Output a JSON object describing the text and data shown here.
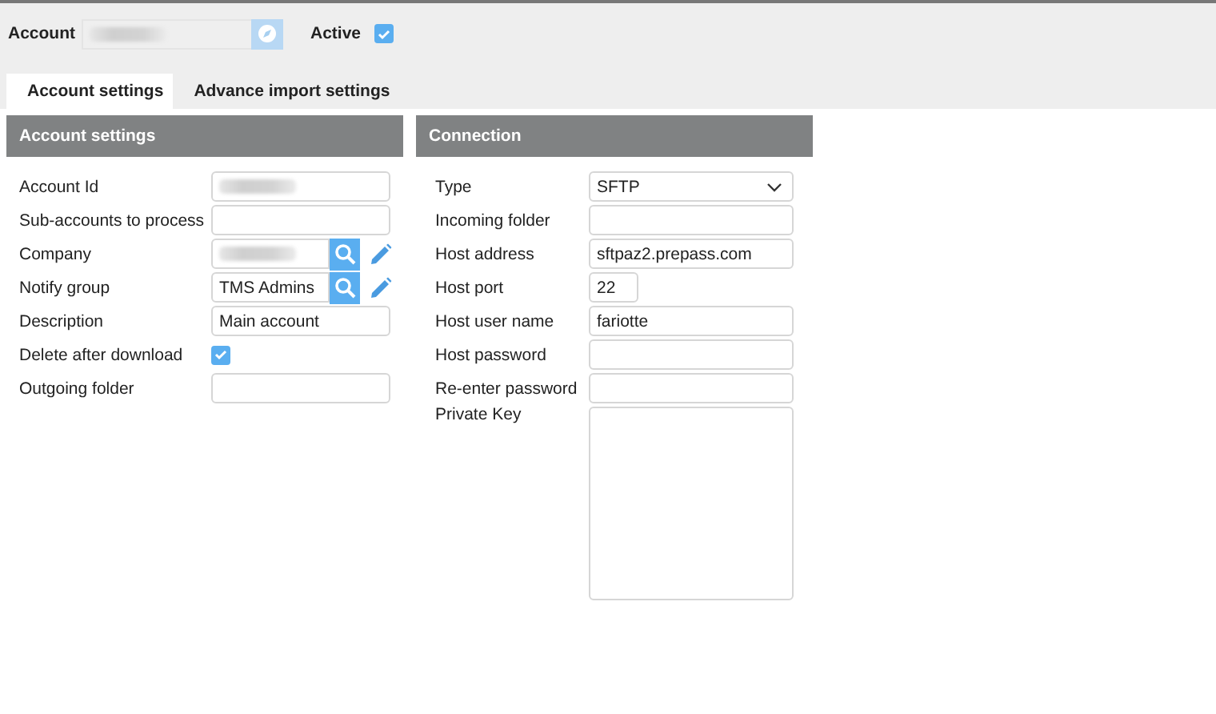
{
  "header": {
    "account": {
      "label": "Account",
      "blurred": true
    },
    "active": {
      "label": "Active",
      "checked": true
    }
  },
  "tabs": [
    {
      "label": "Account settings",
      "selected": true
    },
    {
      "label": "Advance import settings",
      "selected": false
    }
  ],
  "panels": [
    {
      "title": "Account settings",
      "fields": [
        {
          "label": "Account Id",
          "kind": "text",
          "blurred": true
        },
        {
          "label": "Sub-accounts to process",
          "kind": "text"
        },
        {
          "label": "Company",
          "kind": "lookup",
          "blurred": true
        },
        {
          "label": "Notify group",
          "kind": "lookup",
          "value": "TMS Admins"
        },
        {
          "label": "Description",
          "kind": "text",
          "value": "Main account"
        },
        {
          "label": "Delete after download",
          "kind": "checkbox",
          "checked": true
        },
        {
          "label": "Outgoing folder",
          "kind": "text"
        }
      ]
    },
    {
      "title": "Connection",
      "fields": [
        {
          "label": "Type",
          "kind": "select",
          "value": "SFTP"
        },
        {
          "label": "Incoming folder",
          "kind": "text"
        },
        {
          "label": "Host address",
          "kind": "text",
          "value": "sftpaz2.prepass.com"
        },
        {
          "label": "Host port",
          "kind": "short",
          "value": "22"
        },
        {
          "label": "Host user name",
          "kind": "text",
          "value": "fariotte"
        },
        {
          "label": "Host password",
          "kind": "text"
        },
        {
          "label": "Re-enter password",
          "kind": "text"
        },
        {
          "label": "Private Key",
          "kind": "textarea"
        }
      ]
    }
  ]
}
